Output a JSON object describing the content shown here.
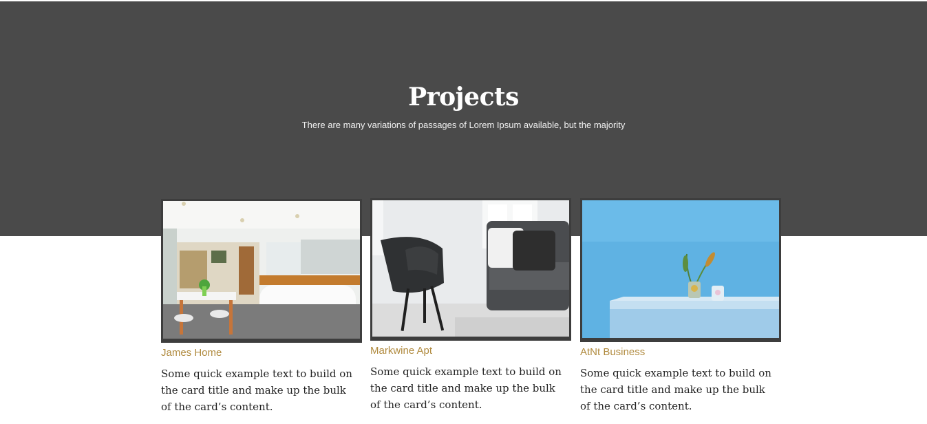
{
  "hero": {
    "title": "Projects",
    "subtitle": "There are many variations of passages of Lorem Ipsum available, but the majority"
  },
  "cards": [
    {
      "title": "James Home",
      "text": "Some quick example text to build on the card title and make up the bulk of the card’s content.",
      "image": "kitchen-photo"
    },
    {
      "title": "Markwine Apt",
      "text": "Some quick example text to build on the card title and make up the bulk of the card’s content.",
      "image": "living-room-chair-photo"
    },
    {
      "title": "AtNt Business",
      "text": "Some quick example text to build on the card title and make up the bulk of the card’s content.",
      "image": "blue-wall-plant-photo"
    }
  ],
  "colors": {
    "hero_bg": "#4a4a4a",
    "card_title": "#b08a3e",
    "body_text": "#222222"
  }
}
